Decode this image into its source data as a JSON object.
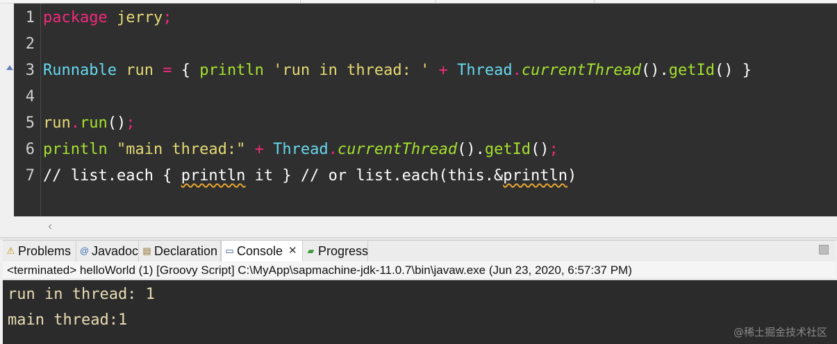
{
  "editor": {
    "line_numbers": [
      "1",
      "2",
      "3",
      "4",
      "5",
      "6",
      "7"
    ],
    "lines": [
      [
        {
          "t": "package",
          "c": "kw"
        },
        {
          "t": " jerry",
          "c": "st"
        },
        {
          "t": ";",
          "c": "op"
        }
      ],
      [],
      [
        {
          "t": "Runnable",
          "c": "ty"
        },
        {
          "t": " run ",
          "c": "st"
        },
        {
          "t": "=",
          "c": "op"
        },
        {
          "t": " { ",
          "c": ""
        },
        {
          "t": "println",
          "c": "fn"
        },
        {
          "t": " 'run in thread: '",
          "c": "st"
        },
        {
          "t": " + ",
          "c": "op"
        },
        {
          "t": "Thread",
          "c": "ty"
        },
        {
          "t": ".",
          "c": "op"
        },
        {
          "t": "currentThread",
          "c": "it"
        },
        {
          "t": "().",
          "c": ""
        },
        {
          "t": "getId",
          "c": "fn"
        },
        {
          "t": "() }",
          "c": ""
        }
      ],
      [],
      [
        {
          "t": "run",
          "c": "st"
        },
        {
          "t": ".",
          "c": "op"
        },
        {
          "t": "run",
          "c": "fn"
        },
        {
          "t": "()",
          "c": ""
        },
        {
          "t": ";",
          "c": "op"
        }
      ],
      [
        {
          "t": "println",
          "c": "fn"
        },
        {
          "t": " \"main thread:\"",
          "c": "st"
        },
        {
          "t": " + ",
          "c": "op"
        },
        {
          "t": "Thread",
          "c": "ty"
        },
        {
          "t": ".",
          "c": "op"
        },
        {
          "t": "currentThread",
          "c": "it"
        },
        {
          "t": "().",
          "c": ""
        },
        {
          "t": "getId",
          "c": "fn"
        },
        {
          "t": "()",
          "c": ""
        },
        {
          "t": ";",
          "c": "op"
        }
      ],
      [
        {
          "t": "// list.each { ",
          "c": ""
        },
        {
          "t": "println",
          "c": "wv"
        },
        {
          "t": " it } // or list.each(this.&",
          "c": ""
        },
        {
          "t": "println",
          "c": "wv"
        },
        {
          "t": ")",
          "c": ""
        }
      ]
    ]
  },
  "tabs": [
    {
      "label": "Problems",
      "icon": "problems-icon",
      "glyph": "⚠"
    },
    {
      "label": "Javadoc",
      "icon": "javadoc-icon",
      "glyph": "@"
    },
    {
      "label": "Declaration",
      "icon": "declaration-icon",
      "glyph": "▤"
    },
    {
      "label": "Console",
      "icon": "console-icon",
      "glyph": "▭",
      "active": true,
      "close": "✕"
    },
    {
      "label": "Progress",
      "icon": "progress-icon",
      "glyph": "▰"
    }
  ],
  "console": {
    "header": "<terminated> helloWorld (1) [Groovy Script] C:\\MyApp\\sapmachine-jdk-11.0.7\\bin\\javaw.exe (Jun 23, 2020, 6:57:37 PM)",
    "output": [
      "run in thread: 1",
      "main thread:1"
    ]
  },
  "watermark": "@稀土掘金技术社区",
  "colors": {
    "editor_bg": "#2f2f2f",
    "keyword": "#f2297a",
    "type": "#66d9ef",
    "method": "#a6e22e",
    "string": "#e6db74",
    "console_bg": "#2b2b2b",
    "console_text": "#e9ddb5"
  }
}
